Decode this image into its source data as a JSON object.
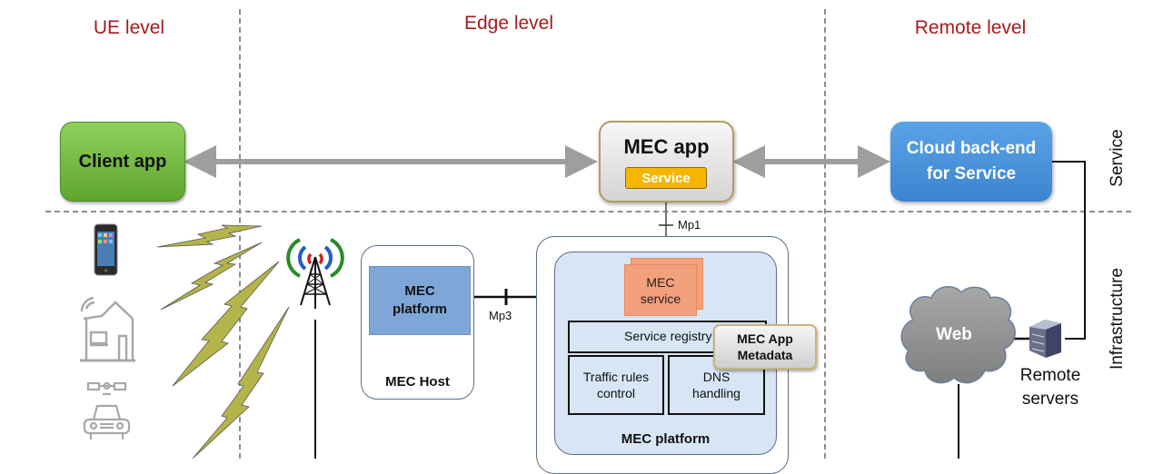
{
  "levels": {
    "ue": "UE level",
    "edge": "Edge  level",
    "remote": "Remote level"
  },
  "layers": {
    "service": "Service",
    "infrastructure": "Infrastructure"
  },
  "service_layer": {
    "client_app": "Client app",
    "mec_app": {
      "title": "MEC app",
      "service_chip": "Service"
    },
    "cloud_backend": {
      "line1": "Cloud back-end",
      "line2": "for Service"
    }
  },
  "interfaces": {
    "mp1": "Mp1",
    "mp3": "Mp3"
  },
  "mec_host": {
    "platform_line1": "MEC",
    "platform_line2": "platform",
    "label": "MEC Host"
  },
  "mec_platform": {
    "service_line1": "MEC",
    "service_line2": "service",
    "service_registry": "Service registry",
    "traffic_line1": "Traffic rules",
    "traffic_line2": "control",
    "dns_line1": "DNS",
    "dns_line2": "handling",
    "metadata_line1": "MEC App",
    "metadata_line2": "Metadata",
    "label": "MEC platform"
  },
  "remote": {
    "web": "Web",
    "servers_line1": "Remote",
    "servers_line2": "servers"
  },
  "ue_devices": [
    "smartphone-icon",
    "smart-home-icon",
    "connected-car-icon"
  ],
  "colors": {
    "level_title": "#a51c1c",
    "client_app": "#6fb43b",
    "mec_app_border": "#b29d63",
    "service_chip": "#f6b600",
    "cloud_backend": "#4a92db",
    "mec_host_platform": "#7ea7d8",
    "mec_service": "#f3a07d",
    "mec_platform_bg": "#d7e5f4",
    "lightning": "#b5b44a",
    "antenna_red": "#d02020",
    "antenna_blue": "#2060c8",
    "antenna_green": "#2a8a2a"
  }
}
